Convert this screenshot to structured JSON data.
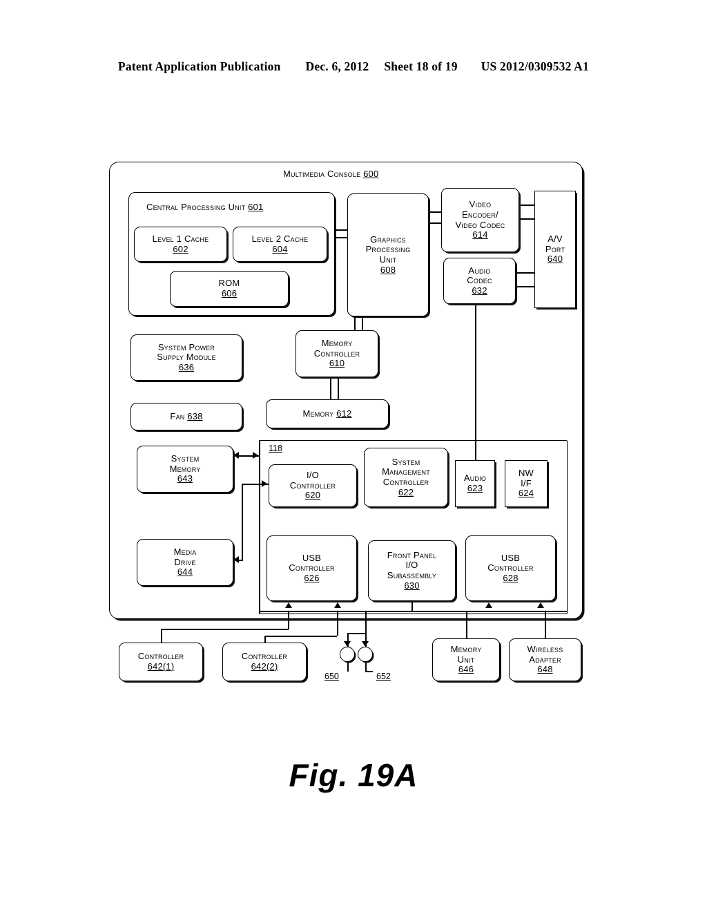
{
  "header": {
    "publication": "Patent Application Publication",
    "date": "Dec. 6, 2012",
    "sheet": "Sheet 18 of 19",
    "number": "US 2012/0309532 A1"
  },
  "figure": {
    "caption": "Fig. 19A",
    "console_title": "Multimedia Console",
    "console_ref": "600"
  },
  "blocks": {
    "cpu": {
      "title": "Central Processing Unit",
      "ref": "601"
    },
    "l1": {
      "line1": "Level 1 Cache",
      "ref": "602"
    },
    "l2": {
      "line1": "Level 2 Cache",
      "ref": "604"
    },
    "rom": {
      "line1": "ROM",
      "ref": "606"
    },
    "gpu": {
      "line1": "Graphics",
      "line2": "Processing",
      "line3": "Unit",
      "ref": "608"
    },
    "video_codec": {
      "line1": "Video",
      "line2": "Encoder/",
      "line3": "Video Codec",
      "ref": "614"
    },
    "audio_codec": {
      "line1": "Audio",
      "line2": "Codec",
      "ref": "632"
    },
    "av_port": {
      "line1": "A/V",
      "line2": "Port",
      "ref": "640"
    },
    "psu": {
      "line1": "System Power",
      "line2": "Supply Module",
      "ref": "636"
    },
    "fan": {
      "line1": "Fan",
      "ref": "638"
    },
    "mem_ctrl": {
      "line1": "Memory",
      "line2": "Controller",
      "ref": "610"
    },
    "memory": {
      "line1": "Memory",
      "ref": "612"
    },
    "sys_mem": {
      "line1": "System",
      "line2": "Memory",
      "ref": "643"
    },
    "media_drive": {
      "line1": "Media",
      "line2": "Drive",
      "ref": "644"
    },
    "io_ctrl": {
      "line1": "I/O",
      "line2": "Controller",
      "ref": "620"
    },
    "smc": {
      "line1": "System",
      "line2": "Management",
      "line3": "Controller",
      "ref": "622"
    },
    "audio": {
      "line1": "Audio",
      "ref": "623"
    },
    "nwif": {
      "line1": "NW",
      "line2": "I/F",
      "ref": "624"
    },
    "usb1": {
      "line1": "USB",
      "line2": "Controller",
      "ref": "626"
    },
    "front_panel": {
      "line1": "Front Panel",
      "line2": "I/O",
      "line3": "Subassembly",
      "ref": "630"
    },
    "usb2": {
      "line1": "USB",
      "line2": "Controller",
      "ref": "628"
    },
    "ctrl1": {
      "line1": "Controller",
      "ref": "642(1)"
    },
    "ctrl2": {
      "line1": "Controller",
      "ref": "642(2)"
    },
    "mem_unit": {
      "line1": "Memory",
      "line2": "Unit",
      "ref": "646"
    },
    "wireless": {
      "line1": "Wireless",
      "line2": "Adapter",
      "ref": "648"
    }
  },
  "labels": {
    "bus_118": "118",
    "port_650": "650",
    "port_652": "652"
  }
}
